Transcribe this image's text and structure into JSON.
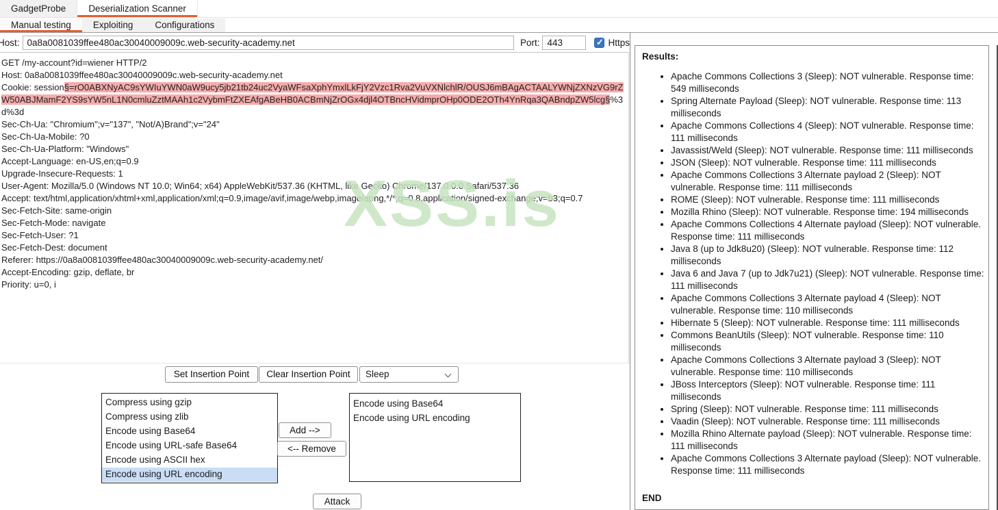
{
  "app": {
    "tabs": [
      {
        "label": "GadgetProbe",
        "selected": false
      },
      {
        "label": "Deserialization Scanner",
        "selected": true
      }
    ],
    "subtabs": [
      {
        "label": "Manual testing",
        "selected": true
      },
      {
        "label": "Exploiting",
        "selected": false
      },
      {
        "label": "Configurations",
        "selected": false
      }
    ]
  },
  "target": {
    "host_label": "Host:",
    "host_value": "0a8a0081039ffee480ac30040009009c.web-security-academy.net",
    "port_label": "Port:",
    "port_value": "443",
    "https_label": "Https",
    "https_checked": true
  },
  "request": {
    "lines_before": [
      "GET /my-account?id=wiener HTTP/2",
      "Host: 0a8a0081039ffee480ac30040009009c.web-security-academy.net"
    ],
    "cookie_prefix": "Cookie: session",
    "cookie_highlighted": "§=rO0ABXNyAC9sYWIuYWN0aW9ucy5jb21tb24uc2VyaWFsaXphYmxlLkFjY2Vzc1Rva2VuVXNlchlR/OUSJ6mBAgACTAALYWNjZXNzVG9rZW50ABJMamF2YS9sYW5nL1N0cmluZztMAAh1c2VybmFtZXEAfgABeHB0ACBmNjZrOGx4djl4OTBncHVidmprOHp0ODE2OTh4YnRqa3QABndpZW5lcg§",
    "cookie_suffix": "%3d%3d",
    "lines_after": [
      "Sec-Ch-Ua: \"Chromium\";v=\"137\", \"Not/A)Brand\";v=\"24\"",
      "Sec-Ch-Ua-Mobile: ?0",
      "Sec-Ch-Ua-Platform: \"Windows\"",
      "Accept-Language: en-US,en;q=0.9",
      "Upgrade-Insecure-Requests: 1",
      "User-Agent: Mozilla/5.0 (Windows NT 10.0; Win64; x64) AppleWebKit/537.36 (KHTML, like Gecko) Chrome/137.0.0.0 Safari/537.36",
      "Accept: text/html,application/xhtml+xml,application/xml;q=0.9,image/avif,image/webp,image/apng,*/*;q=0.8,application/signed-exchange;v=b3;q=0.7",
      "Sec-Fetch-Site: same-origin",
      "Sec-Fetch-Mode: navigate",
      "Sec-Fetch-User: ?1",
      "Sec-Fetch-Dest: document",
      "Referer: https://0a8a0081039ffee480ac30040009009c.web-security-academy.net/",
      "Accept-Encoding: gzip, deflate, br",
      "Priority: u=0, i"
    ]
  },
  "watermark": {
    "text": "XSS.is",
    "color": "#c7e4c1"
  },
  "insertion_controls": {
    "set_button": "Set Insertion Point",
    "clear_button": "Clear Insertion Point",
    "payload_dropdown_value": "Sleep"
  },
  "encoders": {
    "available": [
      {
        "label": "Compress using gzip",
        "selected": false
      },
      {
        "label": "Compress using zlib",
        "selected": false
      },
      {
        "label": "Encode using Base64",
        "selected": false
      },
      {
        "label": "Encode using URL-safe Base64",
        "selected": false
      },
      {
        "label": "Encode using ASCII hex",
        "selected": false
      },
      {
        "label": "Encode using URL encoding",
        "selected": true
      }
    ],
    "applied": [
      "Encode using Base64",
      "Encode using URL encoding"
    ],
    "add_button": "Add -->",
    "remove_button": "<-- Remove"
  },
  "attack_button": "Attack",
  "results": {
    "title": "Results:",
    "items": [
      "Apache Commons Collections 3 (Sleep): NOT vulnerable. Response time: 549 milliseconds",
      "Spring Alternate Payload (Sleep): NOT vulnerable. Response time: 113 milliseconds",
      "Apache Commons Collections 4 (Sleep): NOT vulnerable. Response time: 111 milliseconds",
      "Javassist/Weld (Sleep): NOT vulnerable. Response time: 111 milliseconds",
      "JSON (Sleep): NOT vulnerable. Response time: 111 milliseconds",
      "Apache Commons Collections 3 Alternate payload 2 (Sleep): NOT vulnerable. Response time: 111 milliseconds",
      "ROME (Sleep): NOT vulnerable. Response time: 111 milliseconds",
      "Mozilla Rhino (Sleep): NOT vulnerable. Response time: 194 milliseconds",
      "Apache Commons Collections 4 Alternate payload (Sleep): NOT vulnerable. Response time: 111 milliseconds",
      "Java 8 (up to Jdk8u20) (Sleep): NOT vulnerable. Response time: 112 milliseconds",
      "Java 6 and Java 7 (up to Jdk7u21) (Sleep): NOT vulnerable. Response time: 111 milliseconds",
      "Apache Commons Collections 3 Alternate payload 4 (Sleep): NOT vulnerable. Response time: 110 milliseconds",
      "Hibernate 5 (Sleep): NOT vulnerable. Response time: 111 milliseconds",
      "Commons BeanUtils (Sleep): NOT vulnerable. Response time: 110 milliseconds",
      "Apache Commons Collections 3 Alternate payload 3 (Sleep): NOT vulnerable. Response time: 110 milliseconds",
      "JBoss Interceptors (Sleep): NOT vulnerable. Response time: 111 milliseconds",
      "Spring (Sleep): NOT vulnerable. Response time: 111 milliseconds",
      "Vaadin (Sleep): NOT vulnerable. Response time: 111 milliseconds",
      "Mozilla Rhino Alternate payload (Sleep): NOT vulnerable. Response time: 111 milliseconds",
      "Apache Commons Collections 3 Alternate payload (Sleep): NOT vulnerable. Response time: 111 milliseconds"
    ],
    "end_label": "END"
  },
  "colors": {
    "tab_accent_orange": "#e45f2e",
    "insertion_highlight_pink": "#f6abab",
    "list_selection_blue": "#c9ddf5",
    "checkbox_blue": "#3a77c2",
    "watermark_green": "#c7e4c1"
  }
}
